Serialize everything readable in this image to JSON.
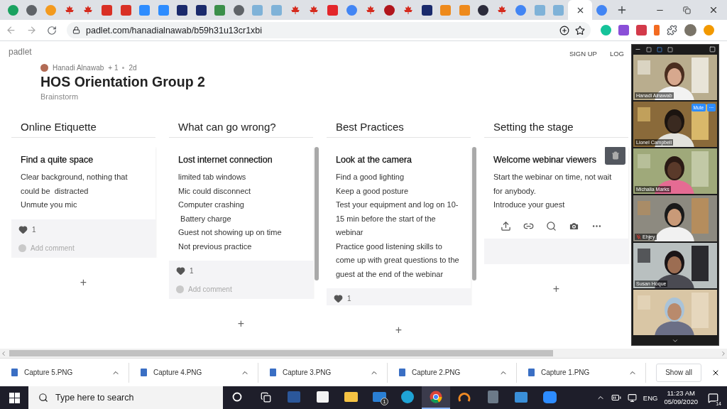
{
  "browser": {
    "tabs": [
      {
        "kind": "circle",
        "color": "#1aa260",
        "selected": false
      },
      {
        "kind": "circle",
        "color": "#5f6368",
        "selected": false
      },
      {
        "kind": "circle",
        "color": "#f39a1e",
        "selected": false
      },
      {
        "kind": "leaf",
        "color": "#d52b1e",
        "selected": false
      },
      {
        "kind": "leaf",
        "color": "#d52b1e",
        "selected": false
      },
      {
        "kind": "square",
        "color": "#d93025",
        "selected": false
      },
      {
        "kind": "square",
        "color": "#d93025",
        "selected": false
      },
      {
        "kind": "square",
        "color": "#2d8cff",
        "selected": false
      },
      {
        "kind": "square",
        "color": "#2d8cff",
        "selected": false
      },
      {
        "kind": "square",
        "color": "#1a2a6c",
        "selected": false
      },
      {
        "kind": "square",
        "color": "#1a2a6c",
        "selected": false
      },
      {
        "kind": "square",
        "color": "#3b8f4a",
        "selected": false
      },
      {
        "kind": "circle",
        "color": "#5f6368",
        "selected": false
      },
      {
        "kind": "square",
        "color": "#7fb2d8",
        "selected": false
      },
      {
        "kind": "square",
        "color": "#7fb2d8",
        "selected": false
      },
      {
        "kind": "leaf",
        "color": "#d52b1e",
        "selected": false
      },
      {
        "kind": "leaf",
        "color": "#d52b1e",
        "selected": false
      },
      {
        "kind": "square",
        "color": "#e3262b",
        "selected": false
      },
      {
        "kind": "circle",
        "color": "#4285f4",
        "selected": false
      },
      {
        "kind": "leaf",
        "color": "#d52b1e",
        "selected": false
      },
      {
        "kind": "circle",
        "color": "#b1151c",
        "selected": false
      },
      {
        "kind": "leaf",
        "color": "#d52b1e",
        "selected": false
      },
      {
        "kind": "square",
        "color": "#1a2a6c",
        "selected": false
      },
      {
        "kind": "square",
        "color": "#ee8a1c",
        "selected": false
      },
      {
        "kind": "square",
        "color": "#ee8a1c",
        "selected": false
      },
      {
        "kind": "circle",
        "color": "#2b2b3b",
        "selected": false
      },
      {
        "kind": "leaf",
        "color": "#d52b1e",
        "selected": false
      },
      {
        "kind": "circle",
        "color": "#4285f4",
        "selected": false
      },
      {
        "kind": "square",
        "color": "#7fb2d8",
        "selected": false
      },
      {
        "kind": "square",
        "color": "#7fb2d8",
        "selected": false
      },
      {
        "selected": true
      },
      {
        "kind": "circle",
        "color": "#4285f4",
        "selected": false
      }
    ],
    "url": "padlet.com/hanadialnawab/b59h31u13cr1xbi"
  },
  "padlet": {
    "logo": "padlet",
    "nav": [
      "SIGN UP",
      "LOG"
    ],
    "author": "Hanadi Alnawab",
    "contributors": "+ 1",
    "age": "2d",
    "title": "HOS Orientation Group 2",
    "subtitle": "Brainstorm"
  },
  "columns": [
    {
      "title": "Online Etiquette",
      "add": "+",
      "posts": [
        {
          "title": "Find a quite space",
          "lines": [
            "Clear background, nothing that could be  distracted",
            "Unmute you mic"
          ],
          "editing": false,
          "likes": "1",
          "comment_placeholder": "Add comment"
        }
      ]
    },
    {
      "title": "What can go wrong?",
      "add": "+",
      "posts": [
        {
          "title": "Lost internet connection",
          "lines": [
            "limited tab windows",
            "Mic could disconnect",
            "Computer crashing",
            " Battery charge",
            "Guest not showing up on time",
            "Not previous practice"
          ],
          "editing": false,
          "likes": "1",
          "comment_placeholder": "Add comment"
        }
      ]
    },
    {
      "title": "Best Practices",
      "add": "+",
      "posts": [
        {
          "title": "Look at the camera",
          "lines": [
            "Find a good lighting",
            "Keep a good posture",
            "Test your equipment and log on 10-15 min before the start of the webinar",
            "Practice good listening skills to come up with great questions to the guest at the end of the webinar"
          ],
          "editing": false,
          "likes": "1"
        }
      ]
    },
    {
      "title": "Setting the stage",
      "add": "+",
      "posts": [
        {
          "title": "Welcome webinar viewers",
          "lines": [
            "Start the webinar on time, not wait for anybody.",
            "Introduce your guest"
          ],
          "editing": true
        }
      ]
    }
  ],
  "meeting": {
    "participants": [
      {
        "name": "Hanadi Alnawab",
        "muted": false
      },
      {
        "name": "Lionel Campbell",
        "muted": false,
        "controls": [
          "Mute",
          "···"
        ]
      },
      {
        "name": "Michalia Marks",
        "muted": false
      },
      {
        "name": "Ehjey",
        "muted": true
      },
      {
        "name": "Susan Hoque",
        "muted": false
      },
      {
        "kind": "picture"
      }
    ]
  },
  "downloads": {
    "items": [
      "Capture 5.PNG",
      "Capture 4.PNG",
      "Capture 3.PNG",
      "Capture 2.PNG",
      "Capture 1.PNG"
    ],
    "show_all": "Show all"
  },
  "taskbar": {
    "search_placeholder": "Type here to search",
    "apps": [
      {
        "kind": "cortana",
        "selected": false
      },
      {
        "kind": "taskview",
        "selected": false
      },
      {
        "kind": "word",
        "selected": false
      },
      {
        "kind": "store",
        "selected": false
      },
      {
        "kind": "explorer",
        "selected": false
      },
      {
        "kind": "mail",
        "selected": false,
        "badge": "1"
      },
      {
        "kind": "edge",
        "selected": false
      },
      {
        "kind": "chrome",
        "selected": true
      },
      {
        "kind": "ring",
        "selected": false
      },
      {
        "kind": "calculator",
        "selected": false
      },
      {
        "kind": "photos",
        "selected": false
      },
      {
        "kind": "camera",
        "selected": false
      }
    ],
    "language": "ENG",
    "time": "11:23 AM",
    "date": "05/09/2020",
    "notifications": "14"
  }
}
